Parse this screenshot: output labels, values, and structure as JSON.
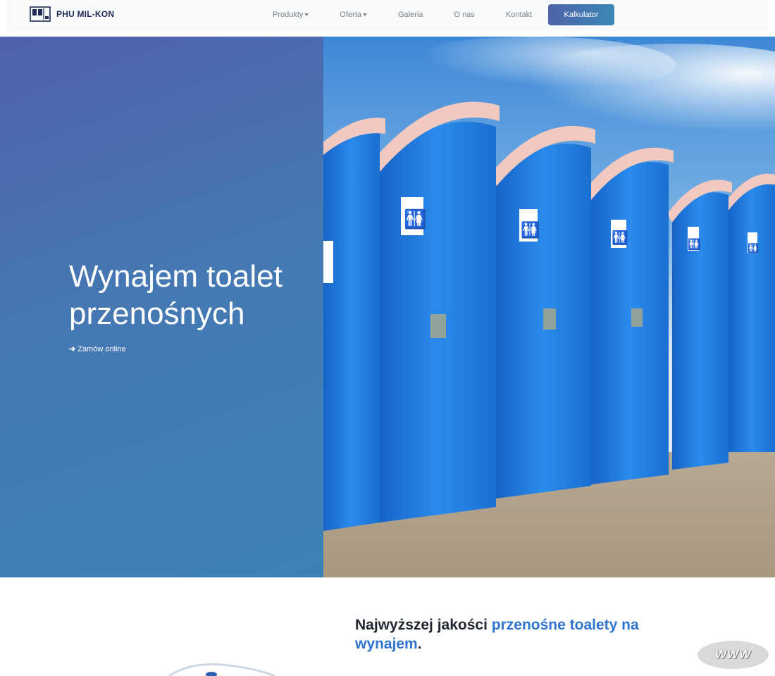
{
  "brand": {
    "name": "PHU MIL-KON",
    "logo_icon": "container-logo-icon"
  },
  "nav": {
    "items": [
      {
        "label": "Produkty",
        "dropdown": true
      },
      {
        "label": "Oferta",
        "dropdown": true
      },
      {
        "label": "Galeria",
        "dropdown": false
      },
      {
        "label": "O nas",
        "dropdown": false
      },
      {
        "label": "Kontakt",
        "dropdown": false
      }
    ],
    "cta_label": "Kalkulator"
  },
  "hero": {
    "title_line1": "Wynajem toalet",
    "title_line2": "przenośnych",
    "cta_label": "Zamów online",
    "cta_icon": "arrow-right-icon",
    "image_signs": [
      "🚻"
    ]
  },
  "section": {
    "title_prefix": "Najwyższej jakości ",
    "title_highlight": "przenośne toalety na wynajem",
    "title_suffix": "."
  },
  "badge": {
    "label": "WWW"
  },
  "colors": {
    "accent": "#2f74d0",
    "hero_gradient_start": "#5061ad",
    "hero_gradient_end": "#3c82b8",
    "toilet_blue": "#1f7ee0",
    "roof_pink": "#f2c9c0"
  }
}
